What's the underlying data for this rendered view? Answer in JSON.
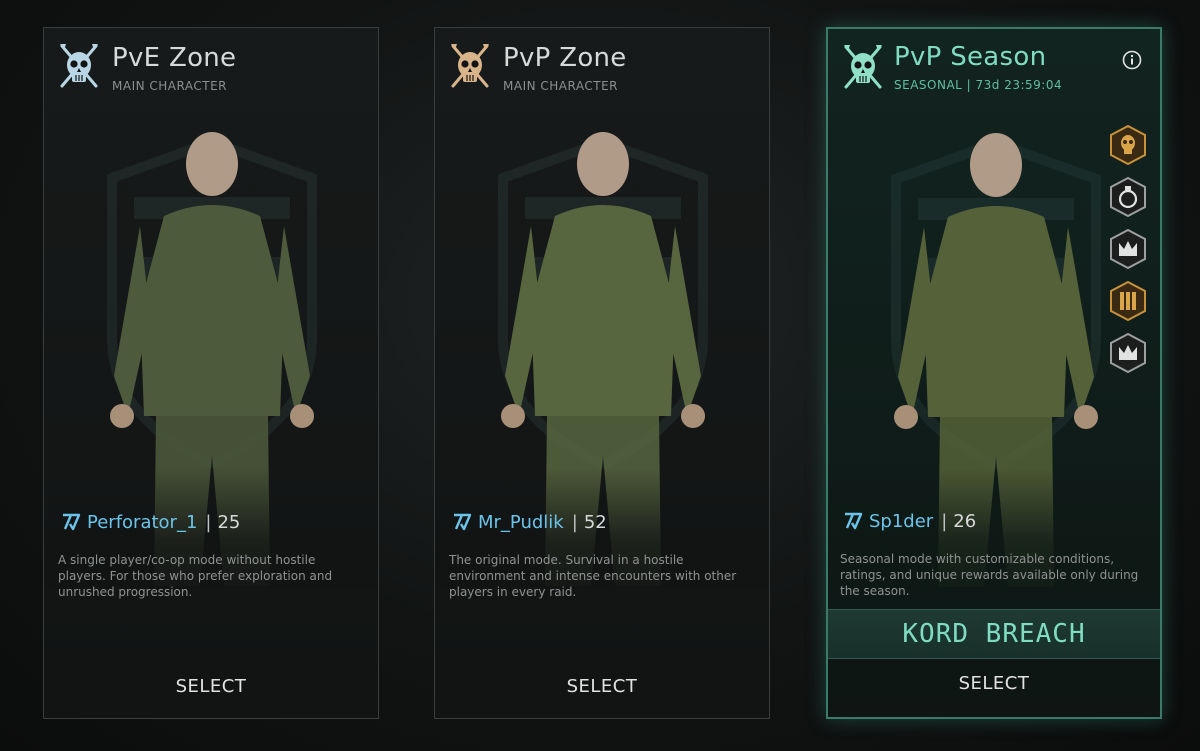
{
  "cards": [
    {
      "title": "PvE Zone",
      "subtitle": "MAIN CHARACTER",
      "player_name": "Perforator_1",
      "player_separator": "|",
      "player_level": "25",
      "description": "A single player/co-op mode without hostile players. For those who prefer exploration and unrushed progression.",
      "select_label": "SELECT",
      "skull_color": "#b9d6e6"
    },
    {
      "title": "PvP Zone",
      "subtitle": "MAIN CHARACTER",
      "player_name": "Mr_Pudlik",
      "player_separator": "|",
      "player_level": "52",
      "description": "The original mode. Survival in a hostile environment and intense encounters with other players in every raid.",
      "select_label": "SELECT",
      "skull_color": "#d9b48a"
    },
    {
      "title": "PvP Season",
      "subtitle": "SEASONAL | 73d 23:59:04",
      "player_name": "Sp1der",
      "player_separator": "|",
      "player_level": "26",
      "description": "Seasonal mode with customizable conditions, ratings, and unique rewards available only during the season.",
      "season_name": "KORD BREACH",
      "select_label": "SELECT",
      "skull_color": "#8fe0c6",
      "badges": [
        "skull-badge-icon",
        "grenade-badge-icon",
        "crown-badge-icon",
        "stripes-badge-icon",
        "crown-badge-icon"
      ]
    }
  ],
  "colors": {
    "accent_teal": "#7fdcc0",
    "player_blue": "#6ac4ea",
    "card_border": "#3a3d3d",
    "selected_border": "#3a7a68"
  }
}
